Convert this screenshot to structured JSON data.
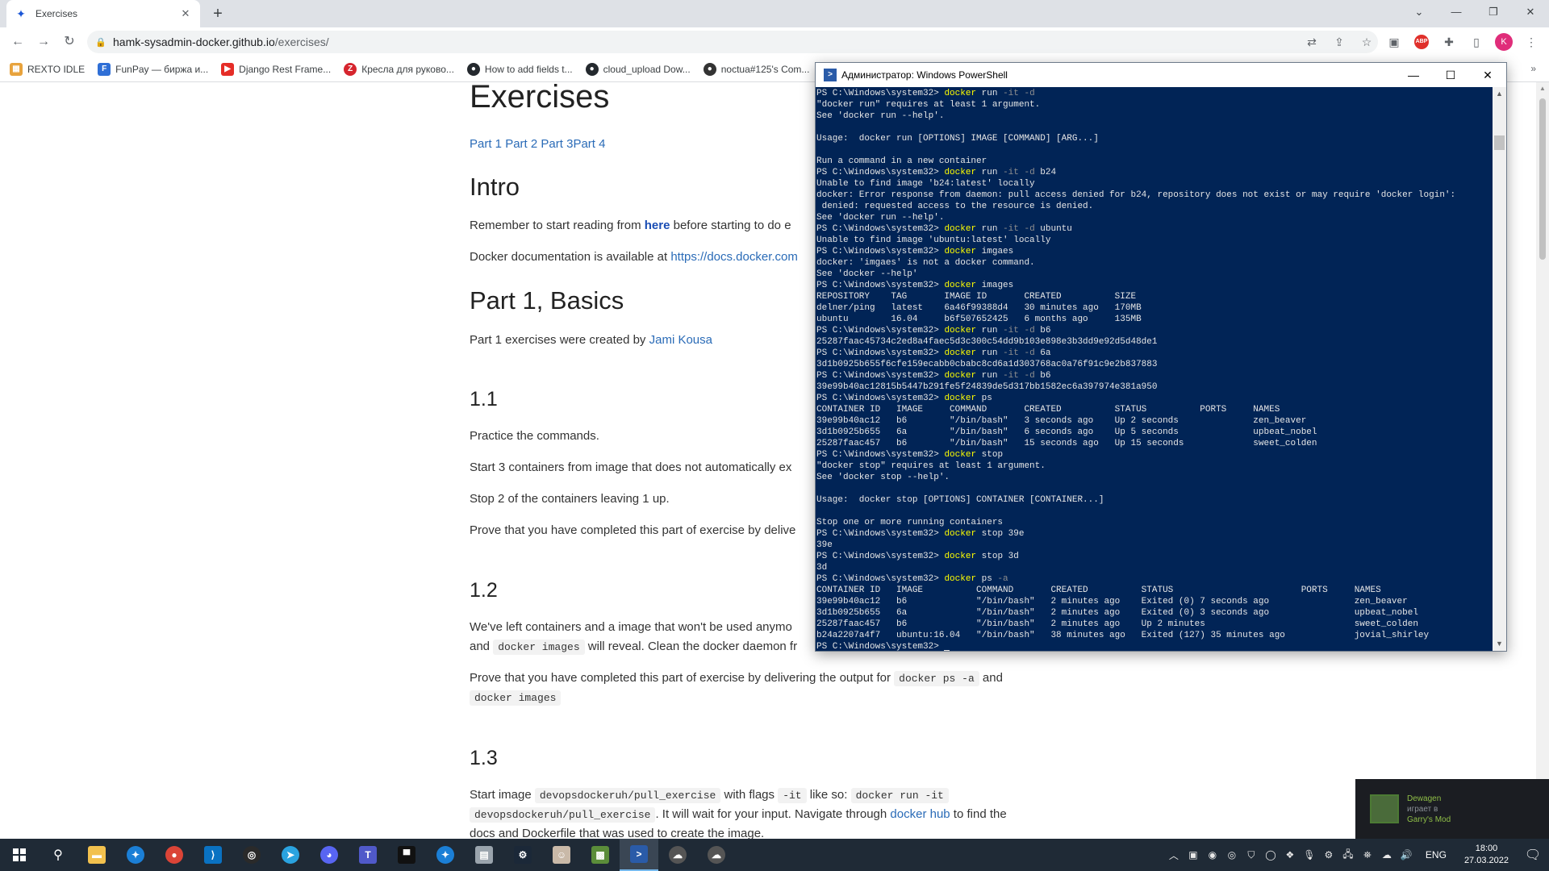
{
  "browser": {
    "tab_title": "Exercises",
    "tab_close": "✕",
    "new_tab": "+",
    "url_host": "hamk-sysadmin-docker.github.io",
    "url_path": "/exercises/",
    "bookmarks": [
      {
        "label": "REXTO IDLE",
        "icon": "rexto-icon",
        "color": "#e8a33d"
      },
      {
        "label": "FunPay — биржа и...",
        "icon": "funpay-icon",
        "color": "#2f6fd6"
      },
      {
        "label": "Django Rest Frame...",
        "icon": "youtube-icon",
        "color": "#e52d27"
      },
      {
        "label": "Кресла для руково...",
        "icon": "zoon-icon",
        "color": "#d6252e"
      },
      {
        "label": "How to add fields t...",
        "icon": "github-icon",
        "color": "#24292e"
      },
      {
        "label": "cloud_upload Dow...",
        "icon": "github-icon",
        "color": "#24292e"
      },
      {
        "label": "noctua#125's Com...",
        "icon": "noctua-icon",
        "color": "#333333"
      }
    ],
    "bookmarks_more": "»",
    "profile_initial": "K",
    "abp_label": "ABP"
  },
  "page": {
    "title": "Exercises",
    "parts_links": [
      "Part 1",
      "Part 2",
      "Part 3",
      "Part 4"
    ],
    "intro_heading": "Intro",
    "intro_text_1a": "Remember to start reading from ",
    "intro_link": "here",
    "intro_text_1b": " before starting to do e",
    "intro_text_2a": "Docker documentation is available at ",
    "intro_text_2_link": "https://docs.docker.com",
    "part1_heading": "Part 1, Basics",
    "part1_text_a": "Part 1 exercises were created by ",
    "part1_author": "Jami Kousa",
    "ex11_heading": "1.1",
    "ex11_p1": "Practice the commands.",
    "ex11_p2": "Start 3 containers from image that does not automatically ex",
    "ex11_p3": "Stop 2 of the containers leaving 1 up.",
    "ex11_p4": "Prove that you have completed this part of exercise by delive",
    "ex12_heading": "1.2",
    "ex12_p1a": "We've left containers and a image that won't be used anymo",
    "ex12_p1b_pre": "and ",
    "ex12_p1b_code": "docker images",
    "ex12_p1b_post": " will reveal. Clean the docker daemon fr",
    "ex12_p2a": "Prove that you have completed this part of exercise by delivering the output for ",
    "ex12_p2_code1": "docker ps -a",
    "ex12_p2_and": " and",
    "ex12_p2_code2": "docker images",
    "ex13_heading": "1.3",
    "ex13_p1_pre": "Start image ",
    "ex13_p1_code1": "devopsdockeruh/pull_exercise",
    "ex13_p1_mid": " with flags ",
    "ex13_p1_code2": "-it",
    "ex13_p1_mid2": " like so: ",
    "ex13_p1_code3": "docker run -it",
    "ex13_p2_code": "devopsdockeruh/pull_exercise",
    "ex13_p2_text": ". It will wait for your input. Navigate through ",
    "ex13_p2_link": "docker hub",
    "ex13_p2_end": " to find the",
    "ex13_p3": "docs and Dockerfile that was used to create the image."
  },
  "powershell": {
    "title": "Администратор: Windows PowerShell",
    "lines": [
      {
        "prompt": "PS C:\\Windows\\system32> ",
        "cmd": "docker",
        "rest": " run ",
        "flag": "-it -d"
      },
      {
        "text": "\"docker run\" requires at least 1 argument."
      },
      {
        "text": "See 'docker run --help'."
      },
      {
        "text": ""
      },
      {
        "text": "Usage:  docker run [OPTIONS] IMAGE [COMMAND] [ARG...]"
      },
      {
        "text": ""
      },
      {
        "text": "Run a command in a new container"
      },
      {
        "prompt": "PS C:\\Windows\\system32> ",
        "cmd": "docker",
        "rest": " run ",
        "flag": "-it -d",
        "tail": " b24"
      },
      {
        "text": "Unable to find image 'b24:latest' locally"
      },
      {
        "text": "docker: Error response from daemon: pull access denied for b24, repository does not exist or may require 'docker login':"
      },
      {
        "text": " denied: requested access to the resource is denied."
      },
      {
        "text": "See 'docker run --help'."
      },
      {
        "prompt": "PS C:\\Windows\\system32> ",
        "cmd": "docker",
        "rest": " run ",
        "flag": "-it -d",
        "tail": " ubuntu"
      },
      {
        "text": "Unable to find image 'ubuntu:latest' locally"
      },
      {
        "prompt": "PS C:\\Windows\\system32> ",
        "cmd": "docker",
        "rest": " imgaes"
      },
      {
        "text": "docker: 'imgaes' is not a docker command."
      },
      {
        "text": "See 'docker --help'"
      },
      {
        "prompt": "PS C:\\Windows\\system32> ",
        "cmd": "docker",
        "rest": " images"
      },
      {
        "text": "REPOSITORY    TAG       IMAGE ID       CREATED          SIZE"
      },
      {
        "text": "delner/ping   latest    6a46f99388d4   30 minutes ago   170MB"
      },
      {
        "text": "ubuntu        16.04     b6f507652425   6 months ago     135MB"
      },
      {
        "prompt": "PS C:\\Windows\\system32> ",
        "cmd": "docker",
        "rest": " run ",
        "flag": "-it -d",
        "tail": " b6"
      },
      {
        "text": "25287faac45734c2ed8a4faec5d3c300c54dd9b103e898e3b3dd9e92d5d48de1"
      },
      {
        "prompt": "PS C:\\Windows\\system32> ",
        "cmd": "docker",
        "rest": " run ",
        "flag": "-it -d",
        "tail": " 6a"
      },
      {
        "text": "3d1b0925b655f6cfe159ecabb0cbabc8cd6a1d303768ac0a76f91c9e2b837883"
      },
      {
        "prompt": "PS C:\\Windows\\system32> ",
        "cmd": "docker",
        "rest": " run ",
        "flag": "-it -d",
        "tail": " b6"
      },
      {
        "text": "39e99b40ac12815b5447b291fe5f24839de5d317bb1582ec6a397974e381a950"
      },
      {
        "prompt": "PS C:\\Windows\\system32> ",
        "cmd": "docker",
        "rest": " ps"
      },
      {
        "text": "CONTAINER ID   IMAGE     COMMAND       CREATED          STATUS          PORTS     NAMES"
      },
      {
        "text": "39e99b40ac12   b6        \"/bin/bash\"   3 seconds ago    Up 2 seconds              zen_beaver"
      },
      {
        "text": "3d1b0925b655   6a        \"/bin/bash\"   6 seconds ago    Up 5 seconds              upbeat_nobel"
      },
      {
        "text": "25287faac457   b6        \"/bin/bash\"   15 seconds ago   Up 15 seconds             sweet_colden"
      },
      {
        "prompt": "PS C:\\Windows\\system32> ",
        "cmd": "docker",
        "rest": " stop"
      },
      {
        "text": "\"docker stop\" requires at least 1 argument."
      },
      {
        "text": "See 'docker stop --help'."
      },
      {
        "text": ""
      },
      {
        "text": "Usage:  docker stop [OPTIONS] CONTAINER [CONTAINER...]"
      },
      {
        "text": ""
      },
      {
        "text": "Stop one or more running containers"
      },
      {
        "prompt": "PS C:\\Windows\\system32> ",
        "cmd": "docker",
        "rest": " stop 39e"
      },
      {
        "text": "39e"
      },
      {
        "prompt": "PS C:\\Windows\\system32> ",
        "cmd": "docker",
        "rest": " stop 3d"
      },
      {
        "text": "3d"
      },
      {
        "prompt": "PS C:\\Windows\\system32> ",
        "cmd": "docker",
        "rest": " ps ",
        "flag": "-a"
      },
      {
        "text": "CONTAINER ID   IMAGE          COMMAND       CREATED          STATUS                        PORTS     NAMES"
      },
      {
        "text": "39e99b40ac12   b6             \"/bin/bash\"   2 minutes ago    Exited (0) 7 seconds ago                zen_beaver"
      },
      {
        "text": "3d1b0925b655   6a             \"/bin/bash\"   2 minutes ago    Exited (0) 3 seconds ago                upbeat_nobel"
      },
      {
        "text": "25287faac457   b6             \"/bin/bash\"   2 minutes ago    Up 2 minutes                            sweet_colden"
      },
      {
        "text": "b24a2207a4f7   ubuntu:16.04   \"/bin/bash\"   38 minutes ago   Exited (127) 35 minutes ago             jovial_shirley"
      },
      {
        "prompt": "PS C:\\Windows\\system32> ",
        "cursor": true
      }
    ]
  },
  "toast": {
    "user": "Dewagen",
    "status": "играет в",
    "game": "Garry's Mod"
  },
  "taskbar": {
    "lang": "ENG",
    "time": "18:00",
    "date": "27.03.2022"
  }
}
